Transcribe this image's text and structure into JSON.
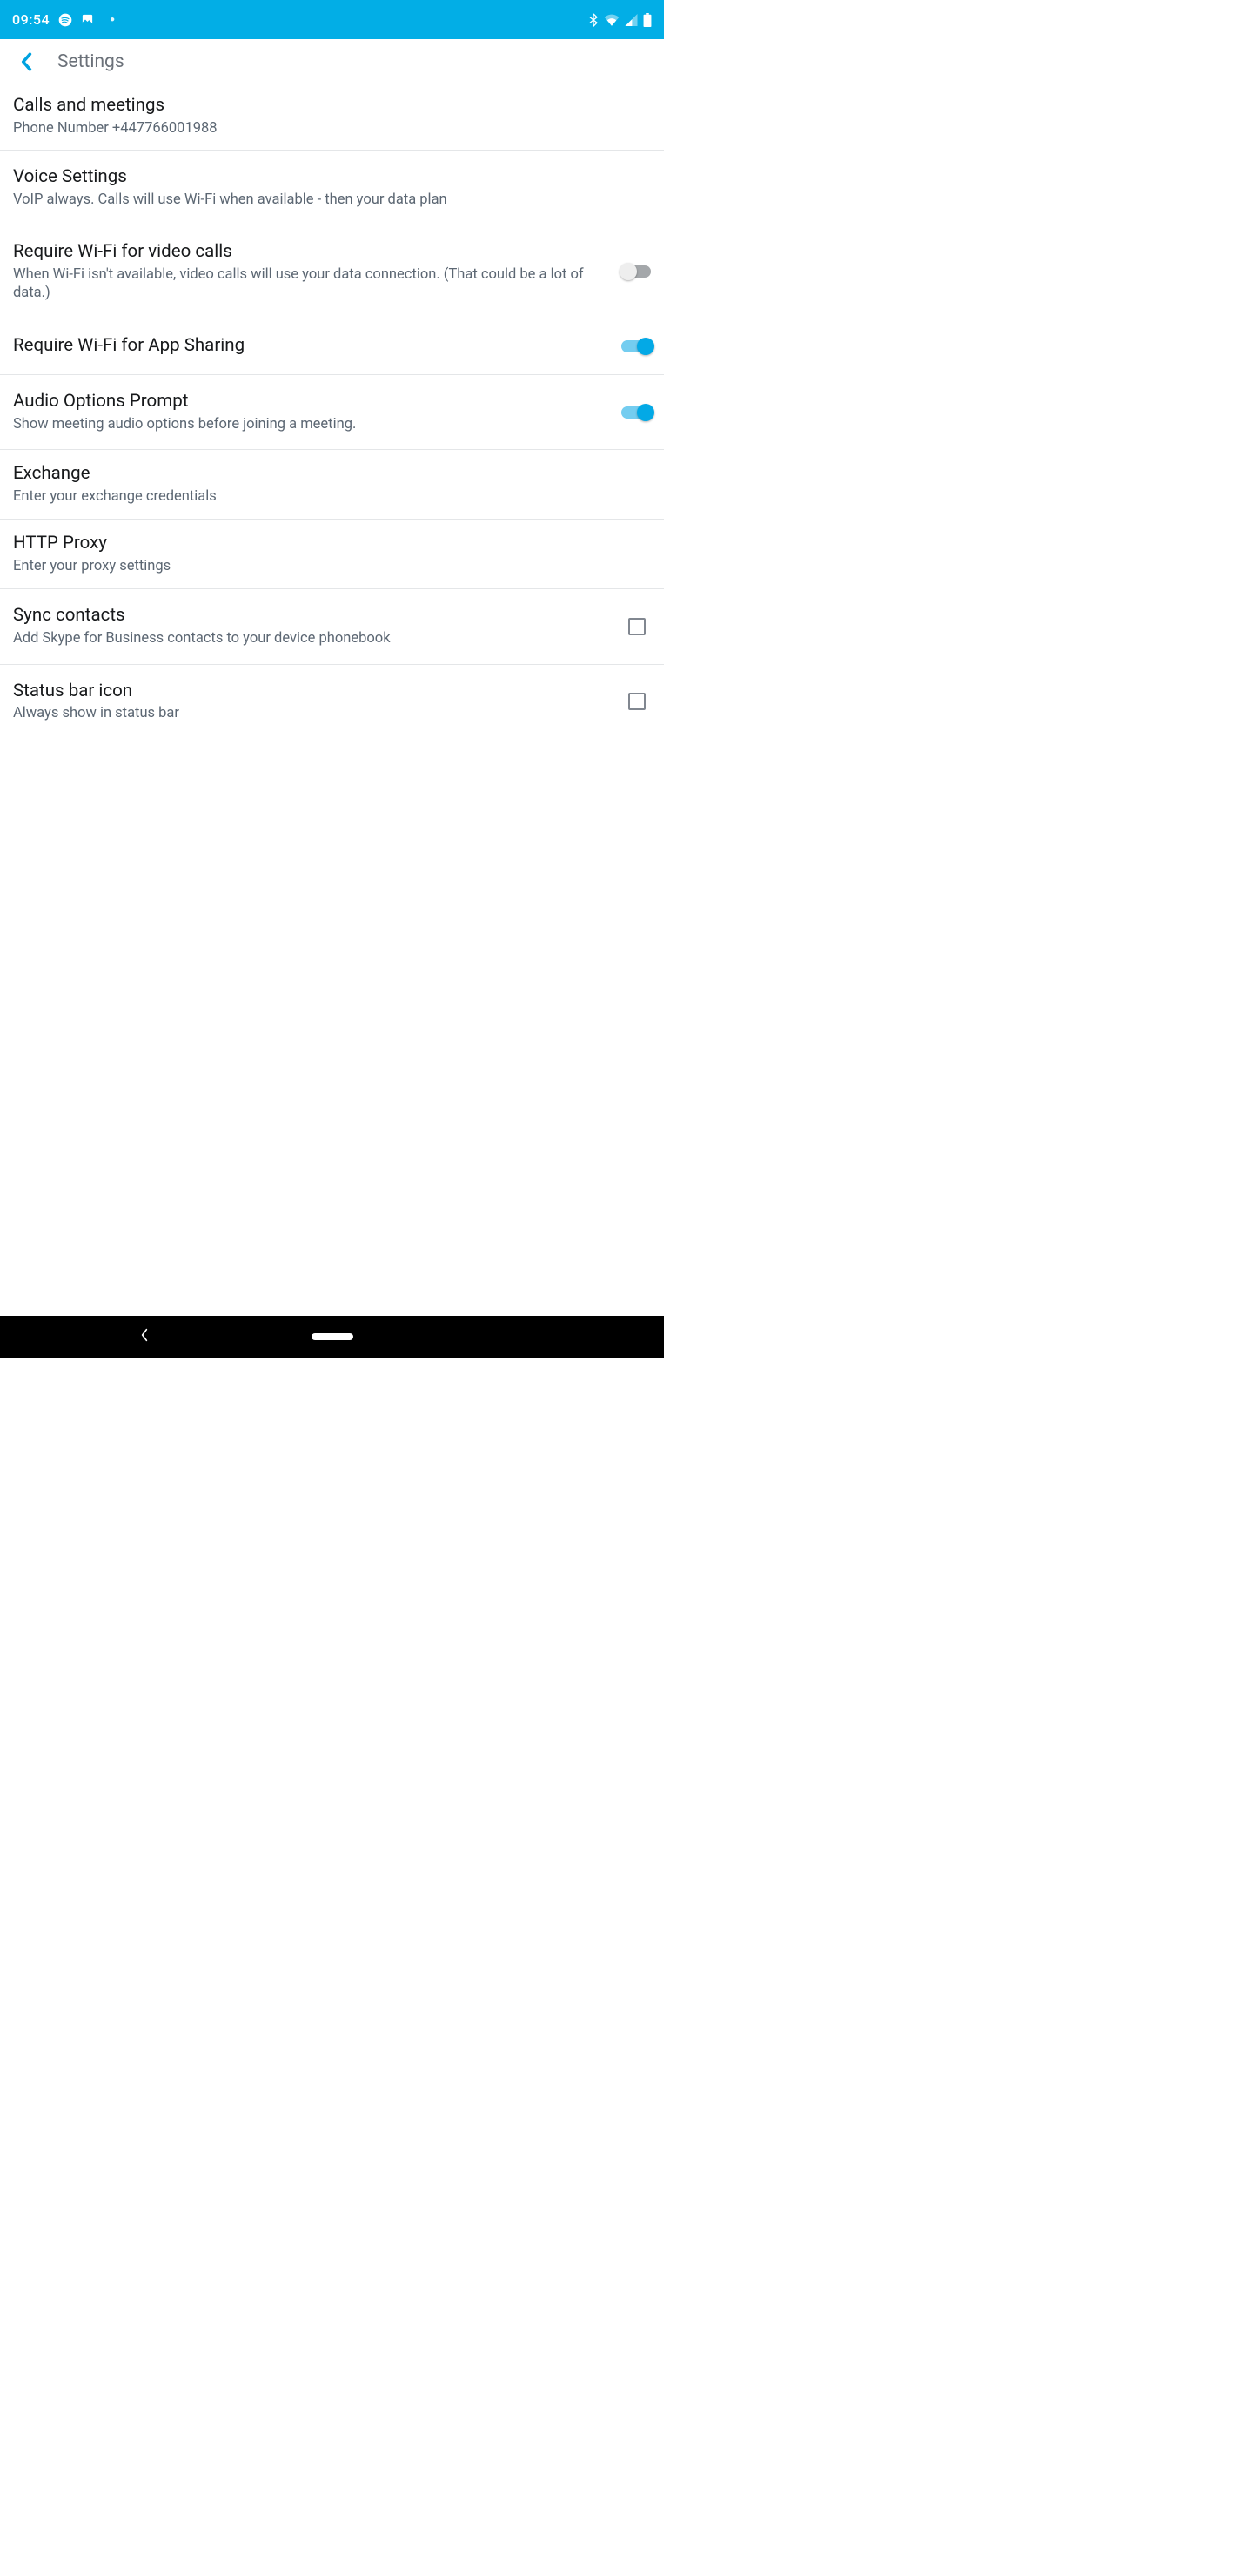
{
  "status": {
    "time": "09:54"
  },
  "header": {
    "title": "Settings"
  },
  "rows": {
    "calls": {
      "title": "Calls and meetings",
      "sub": "Phone Number +447766001988"
    },
    "voice": {
      "title": "Voice Settings",
      "sub": "VoIP always. Calls will use Wi-Fi when available - then your data plan"
    },
    "wifiVideo": {
      "title": "Require Wi-Fi for video calls",
      "sub": "When Wi-Fi isn't available, video calls will use your data connection. (That could be a lot of data.)",
      "on": false
    },
    "wifiShare": {
      "title": "Require Wi-Fi for App Sharing",
      "on": true
    },
    "audioPrompt": {
      "title": "Audio Options Prompt",
      "sub": "Show meeting audio options before joining a meeting.",
      "on": true
    },
    "exchange": {
      "title": "Exchange",
      "sub": "Enter your exchange credentials"
    },
    "proxy": {
      "title": "HTTP Proxy",
      "sub": "Enter your proxy settings"
    },
    "sync": {
      "title": "Sync contacts",
      "sub": "Add Skype for Business contacts to your device phonebook",
      "checked": false
    },
    "statusIcon": {
      "title": "Status bar icon",
      "sub": "Always show in status bar",
      "checked": false
    }
  }
}
